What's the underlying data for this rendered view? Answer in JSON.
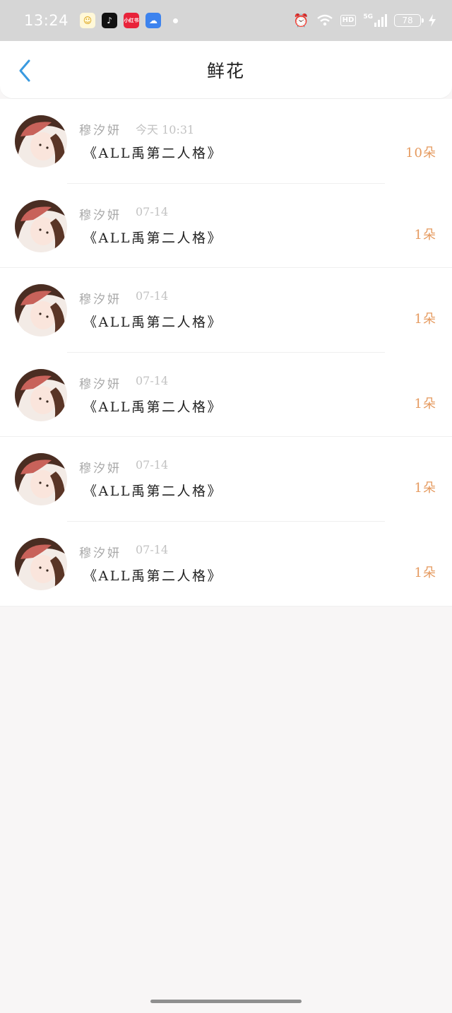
{
  "status_bar": {
    "time": "13:24",
    "app_icons": [
      "gaode-icon",
      "tiktok-icon",
      "xiaohongshu-icon",
      "cloud-icon"
    ],
    "app_labels": {
      "xhs": "小红书"
    },
    "hd_label": "HD",
    "network": "5G",
    "battery": "78"
  },
  "header": {
    "title": "鲜花"
  },
  "flowers": [
    {
      "name": "穆汐妍",
      "time": "今天 10:31",
      "book": "《ALL禹第二人格》",
      "count": "10朵"
    },
    {
      "name": "穆汐妍",
      "time": "07-14",
      "book": "《ALL禹第二人格》",
      "count": "1朵"
    },
    {
      "name": "穆汐妍",
      "time": "07-14",
      "book": "《ALL禹第二人格》",
      "count": "1朵"
    },
    {
      "name": "穆汐妍",
      "time": "07-14",
      "book": "《ALL禹第二人格》",
      "count": "1朵"
    },
    {
      "name": "穆汐妍",
      "time": "07-14",
      "book": "《ALL禹第二人格》",
      "count": "1朵"
    },
    {
      "name": "穆汐妍",
      "time": "07-14",
      "book": "《ALL禹第二人格》",
      "count": "1朵"
    }
  ],
  "colors": {
    "accent_back": "#3a9ae0",
    "count": "#e59a5f",
    "status_bar_bg": "#d6d6d6",
    "page_bg": "#f8f6f6"
  }
}
